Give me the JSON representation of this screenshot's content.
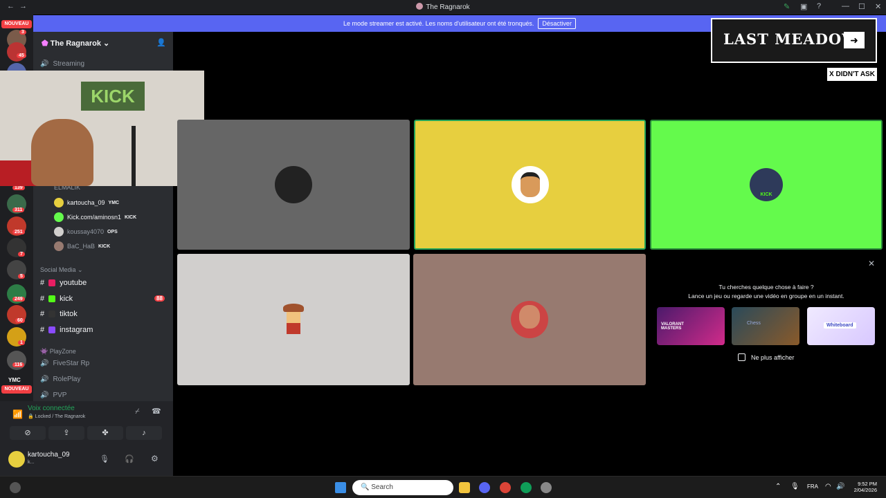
{
  "window": {
    "title": "The Ragnarok"
  },
  "notice": {
    "text": "Le mode streamer est activé. Les noms d'utilisateur ont été tronqués.",
    "button": "Désactiver"
  },
  "rail": {
    "new_badge": "NOUVEAU",
    "badges": [
      "3",
      "45",
      "139",
      "311",
      "251",
      "7",
      "5",
      "249",
      "60",
      "1",
      "116"
    ],
    "ymc": "YMC",
    "new_badge_bottom": "NOUVEAU"
  },
  "sidebar": {
    "server_name": "The Ragnarok",
    "top_channel": "Streaming",
    "partial_member": "ELMALIK",
    "members": [
      {
        "name": "kartoucha_09",
        "tag": "YMC"
      },
      {
        "name": "Kick.com/aminosn1",
        "tag": "KICK"
      },
      {
        "name": "koussay4070",
        "tag": "OPS"
      },
      {
        "name": "BaC_HaB",
        "tag": "KICK"
      }
    ],
    "category_social": "Social Media",
    "text_channels": [
      {
        "name": "youtube",
        "color": "#e91e63"
      },
      {
        "name": "kick",
        "color": "#53fc18",
        "badge": "88"
      },
      {
        "name": "tiktok",
        "color": "#333333"
      },
      {
        "name": "instagram",
        "color": "#8a4bff"
      }
    ],
    "category_play": "PlayZone",
    "voice_channels": [
      "FiveStar Rp",
      "RolePlay",
      "PVP"
    ]
  },
  "voice": {
    "status": "Voix connectée",
    "location": "Locked / The Ragnarok"
  },
  "user": {
    "name": "kartoucha_09",
    "sub": "k..."
  },
  "tiles": {
    "colors": [
      "#666666",
      "#e7cf3f",
      "#64fa4c",
      "#d1cfcd",
      "#977a70"
    ],
    "kick_label": "KICK"
  },
  "activity": {
    "line1": "Tu cherches quelque chose à faire ?",
    "line2": "Lance un jeu ou regarde une vidéo en groupe en un instant.",
    "cards": [
      "VALORANT MASTERS",
      "Chess",
      "Whiteboard"
    ],
    "checkbox": "Ne plus afficher"
  },
  "overlay": {
    "banner": "LAST MEADOW",
    "didnt_ask": "X DIDN'T ASK"
  },
  "webcam": {
    "sign": "KICK"
  },
  "taskbar": {
    "search_placeholder": "Search",
    "lang": "FRA",
    "time": "9:52 PM",
    "date": "2/04/2026"
  }
}
